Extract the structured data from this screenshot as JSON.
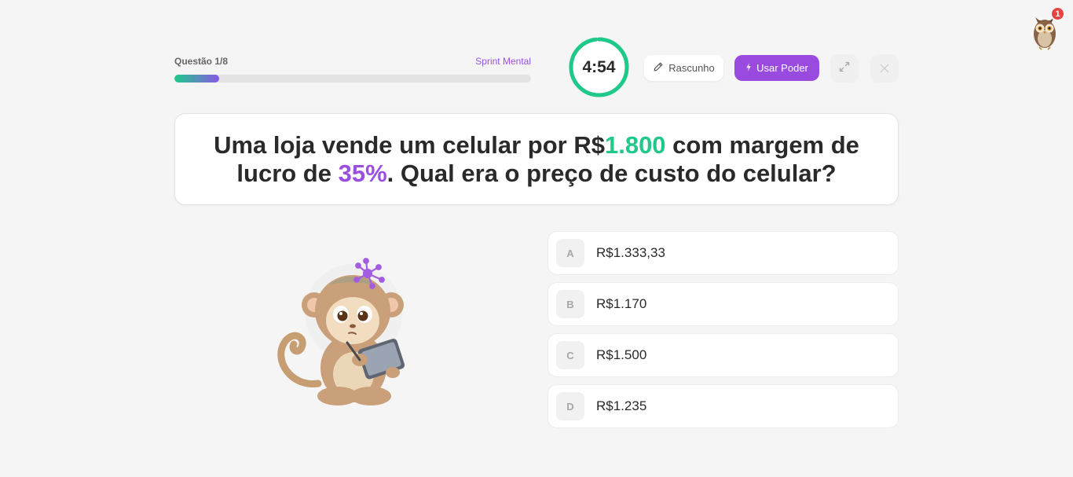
{
  "progress": {
    "label": "Questão 1/8",
    "mode": "Sprint Mental",
    "fraction": 0.125
  },
  "timer": {
    "value": "4:54",
    "fraction_remaining": 0.98
  },
  "toolbar": {
    "draft_label": "Rascunho",
    "power_label": "Usar Poder"
  },
  "notifications": {
    "count": "1"
  },
  "question": {
    "part1": "Uma loja vende um celular por R$",
    "price": "1.800",
    "part2": " com margem de lucro de ",
    "percent": "35%",
    "part3": ". Qual era o preço de custo do celular?"
  },
  "options": [
    {
      "letter": "A",
      "text": "R$1.333,33"
    },
    {
      "letter": "B",
      "text": "R$1.170"
    },
    {
      "letter": "C",
      "text": "R$1.500"
    },
    {
      "letter": "D",
      "text": "R$1.235"
    }
  ],
  "colors": {
    "accent_green": "#1fc98a",
    "accent_purple": "#9b4fe0",
    "badge_red": "#e74242"
  }
}
